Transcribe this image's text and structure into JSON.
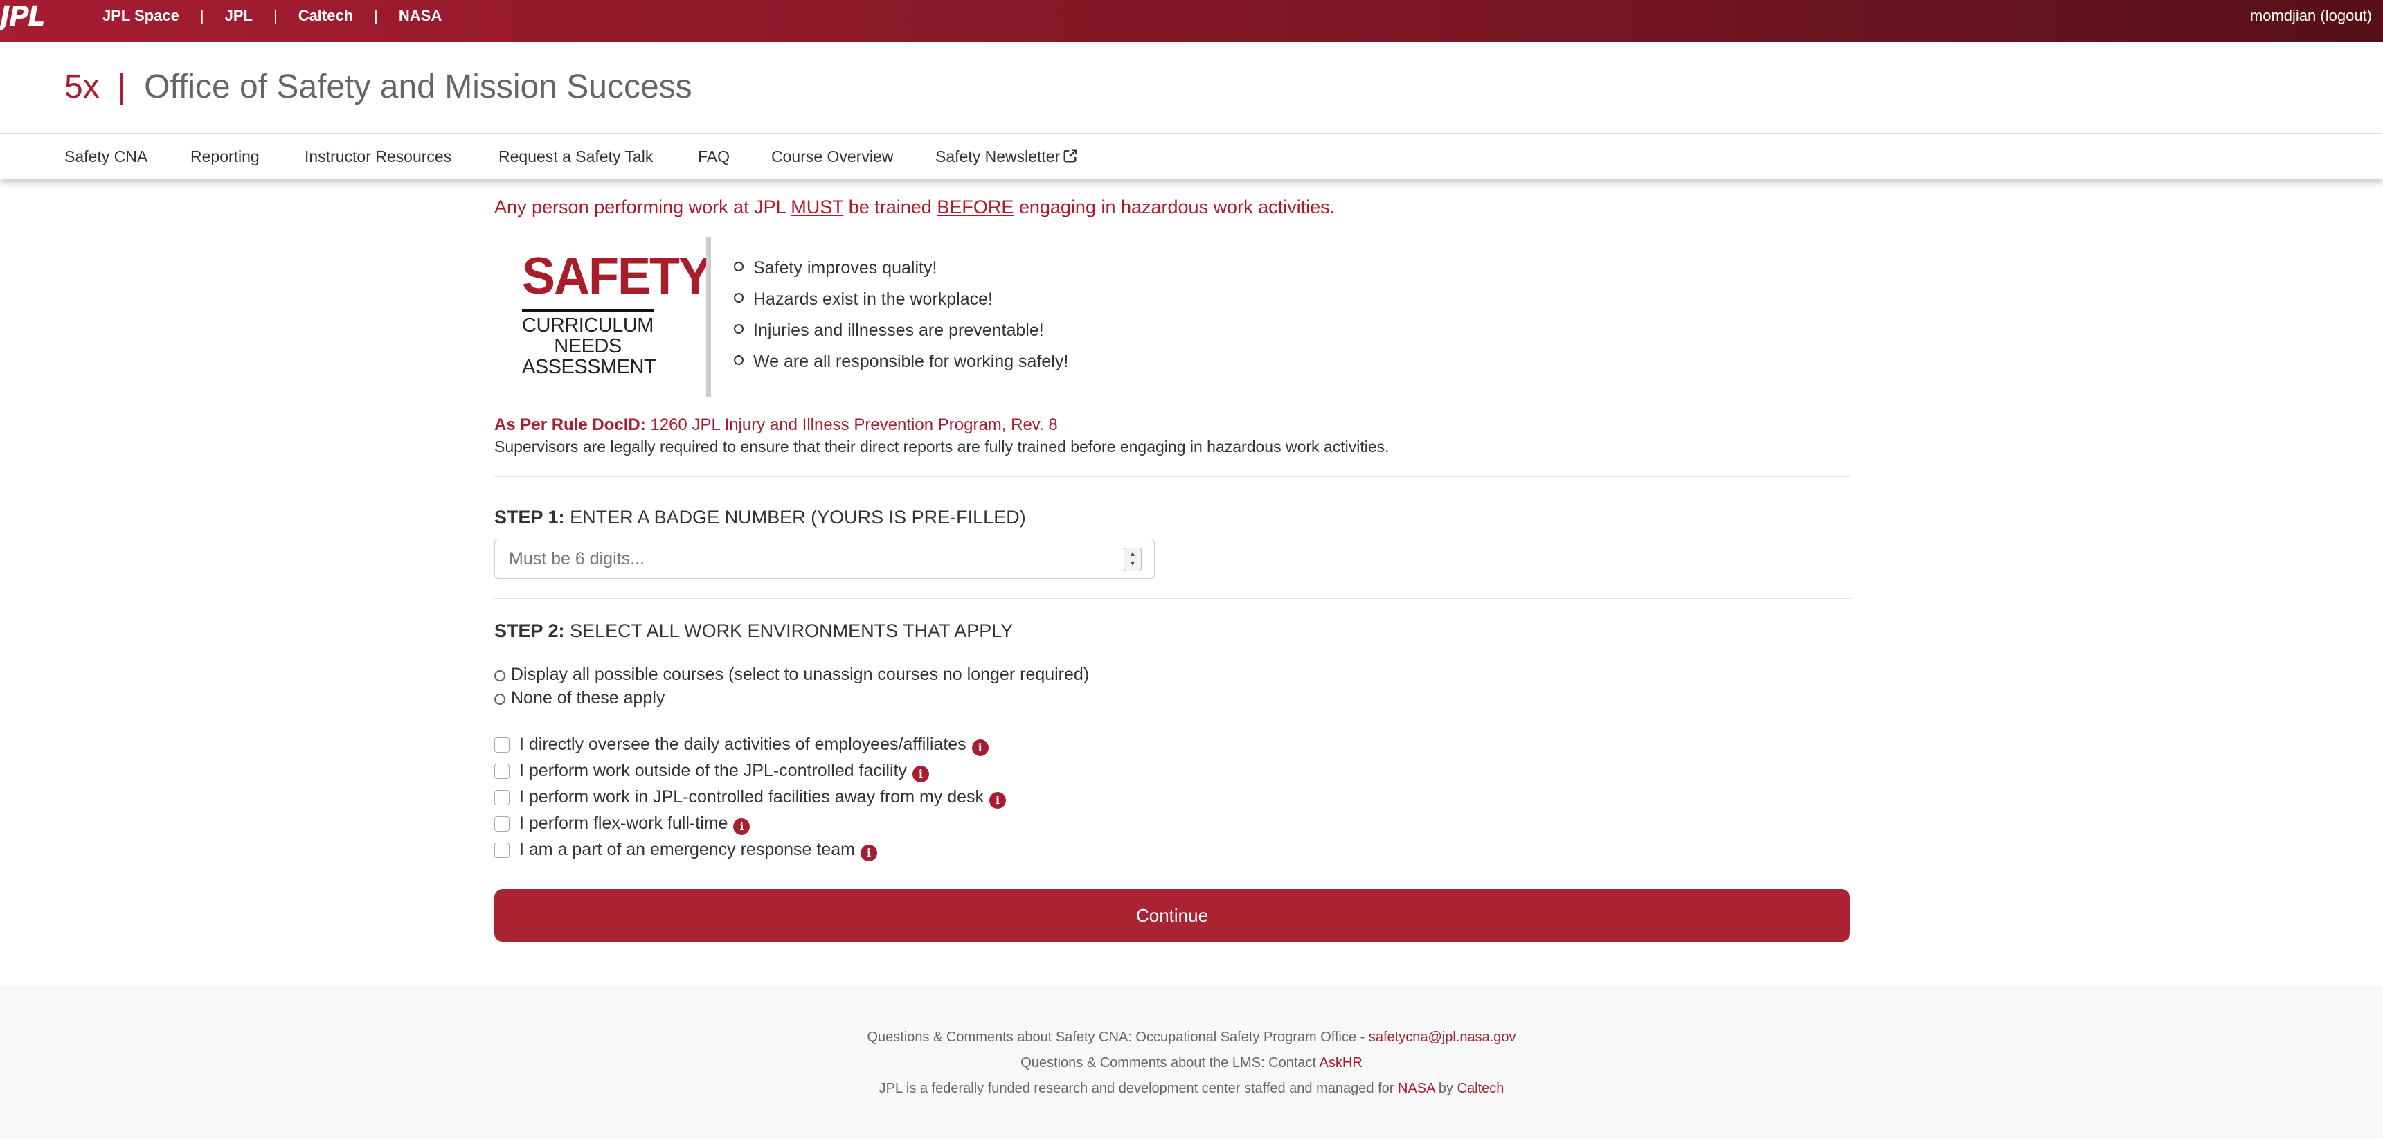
{
  "topbar": {
    "logo": "JPL",
    "links": [
      "JPL Space",
      "JPL",
      "Caltech",
      "NASA"
    ],
    "separator": "|",
    "user": "momdjian",
    "logout": "(logout)"
  },
  "header": {
    "code": "5x",
    "separator": "|",
    "title": "Office of Safety and Mission Success"
  },
  "nav": {
    "items": [
      "Safety CNA",
      "Reporting",
      "Instructor Resources",
      "Request a Safety Talk",
      "FAQ",
      "Course Overview",
      "Safety Newsletter"
    ]
  },
  "main": {
    "warning": {
      "part1": "Any person performing work at JPL ",
      "must": "MUST",
      "part2": " be trained ",
      "before": "BEFORE",
      "part3": " engaging in hazardous work activities."
    },
    "logo": {
      "title": "SAFETY",
      "line1": "CURRICULUM",
      "line2": "NEEDS",
      "line3": "ASSESSMENT"
    },
    "bullets": [
      "Safety improves quality!",
      "Hazards exist in the workplace!",
      "Injuries and illnesses are preventable!",
      "We are all responsible for working safely!"
    ],
    "rule": {
      "label": "As Per Rule DocID:",
      "link": "1260 JPL Injury and Illness Prevention Program, Rev. 8"
    },
    "supervisors": "Supervisors are legally required to ensure that their direct reports are fully trained before engaging in hazardous work activities.",
    "step1": {
      "label": "STEP 1:",
      "text": "ENTER A BADGE NUMBER (YOURS IS PRE-FILLED)",
      "placeholder": "Must be 6 digits..."
    },
    "step2": {
      "label": "STEP 2:",
      "text": "SELECT ALL WORK ENVIRONMENTS THAT APPLY",
      "radios": [
        "Display all possible courses (select to unassign courses no longer required)",
        "None of these apply"
      ],
      "checkboxes": [
        "I directly oversee the daily activities of employees/affiliates",
        "I perform work outside of the JPL-controlled facility",
        "I perform work in JPL-controlled facilities away from my desk",
        "I perform flex-work full-time",
        "I am a part of an emergency response team"
      ]
    },
    "continue": "Continue"
  },
  "footer": {
    "line1_text": "Questions & Comments about Safety CNA: Occupational Safety Program Office - ",
    "line1_link": "safetycna@jpl.nasa.gov",
    "line2_text": "Questions & Comments about the LMS: Contact ",
    "line2_link": "AskHR",
    "line3_text": "JPL is a federally funded research and development center staffed and managed for ",
    "line3_link1": "NASA",
    "line3_by": " by ",
    "line3_link2": "Caltech"
  },
  "colors": {
    "brand": "#a71d31",
    "button": "#ab2332"
  }
}
